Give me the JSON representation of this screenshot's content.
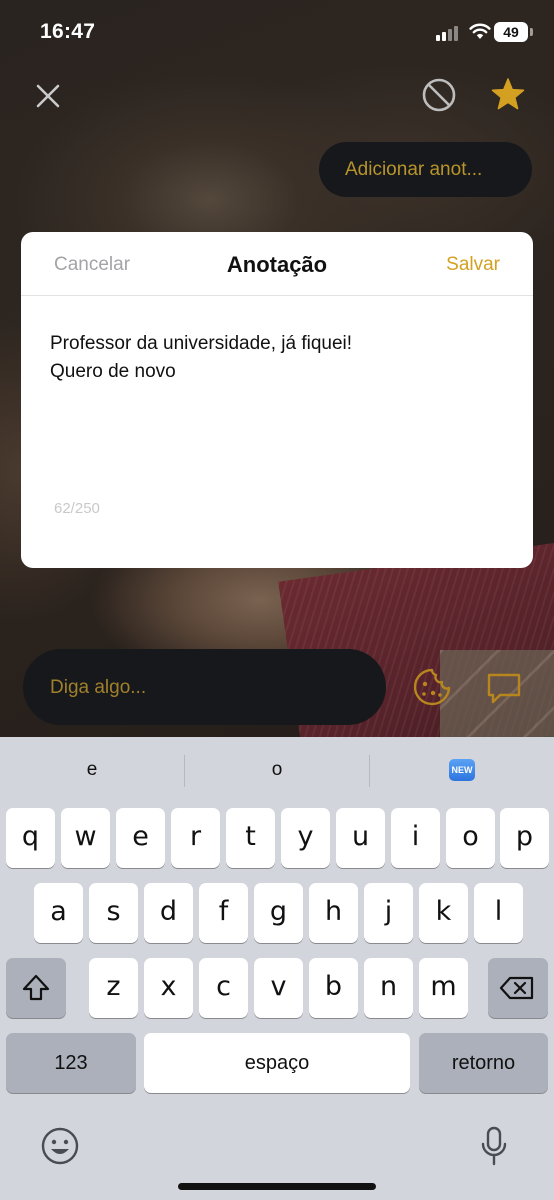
{
  "status_bar": {
    "time": "16:47",
    "battery": "49"
  },
  "top_bar": {
    "note_button": "Adicionar anot..."
  },
  "modal": {
    "cancel": "Cancelar",
    "title": "Anotação",
    "save": "Salvar",
    "text": "Professor da universidade, já fiquei!\nQuero de novo",
    "counter": "62/250"
  },
  "composer": {
    "placeholder": "Diga algo..."
  },
  "keyboard": {
    "suggestions": [
      "e",
      "o"
    ],
    "suggestion_emoji": "NEW",
    "row1": [
      "q",
      "w",
      "e",
      "r",
      "t",
      "y",
      "u",
      "i",
      "o",
      "p"
    ],
    "row2": [
      "a",
      "s",
      "d",
      "f",
      "g",
      "h",
      "j",
      "k",
      "l"
    ],
    "row3": [
      "z",
      "x",
      "c",
      "v",
      "b",
      "n",
      "m"
    ],
    "numbers": "123",
    "space": "espaço",
    "return": "retorno"
  },
  "colors": {
    "accent": "#d4a021",
    "placeholder": "#a0802a",
    "keyboard_bg": "#d3d5dc"
  }
}
